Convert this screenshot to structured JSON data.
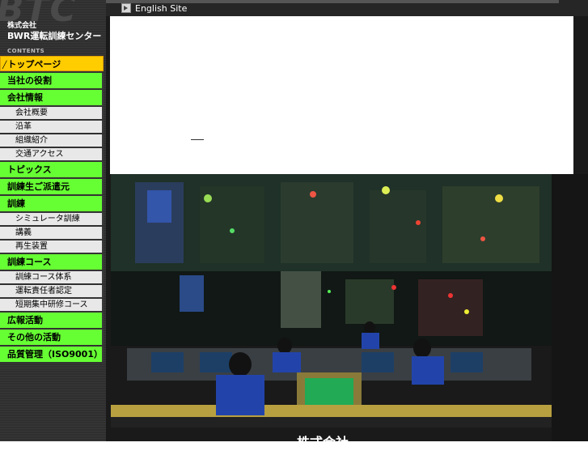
{
  "logo": {
    "watermark": "BTC",
    "company_small": "株式会社",
    "company_name": "BWR運転訓練センター"
  },
  "sidebar": {
    "contents_label": "CONTENTS",
    "items": [
      {
        "label": "トップページ",
        "type": "main",
        "active": true
      },
      {
        "label": "当社の役割",
        "type": "main"
      },
      {
        "label": "会社情報",
        "type": "main"
      },
      {
        "label": "会社概要",
        "type": "sub"
      },
      {
        "label": "沿革",
        "type": "sub"
      },
      {
        "label": "組織紹介",
        "type": "sub"
      },
      {
        "label": "交通アクセス",
        "type": "sub"
      },
      {
        "label": "トピックス",
        "type": "main"
      },
      {
        "label": "訓練生ご派遣元",
        "type": "main"
      },
      {
        "label": "訓練",
        "type": "main"
      },
      {
        "label": "シミュレータ訓練",
        "type": "sub"
      },
      {
        "label": "講義",
        "type": "sub"
      },
      {
        "label": "再生装置",
        "type": "sub"
      },
      {
        "label": "訓練コース",
        "type": "main"
      },
      {
        "label": "訓練コース体系",
        "type": "sub"
      },
      {
        "label": "運転責任者認定",
        "type": "sub"
      },
      {
        "label": "短期集中研修コース",
        "type": "sub"
      },
      {
        "label": "広報活動",
        "type": "main"
      },
      {
        "label": "その他の活動",
        "type": "main"
      },
      {
        "label": "品質管理（ISO9001）",
        "type": "main"
      }
    ]
  },
  "header": {
    "english_link": "English Site"
  },
  "main": {
    "bottom_title": "株式会社"
  },
  "colors": {
    "nav_green": "#66ff33",
    "nav_active": "#ffcc00",
    "sidebar_bg": "#2f2f2f"
  }
}
